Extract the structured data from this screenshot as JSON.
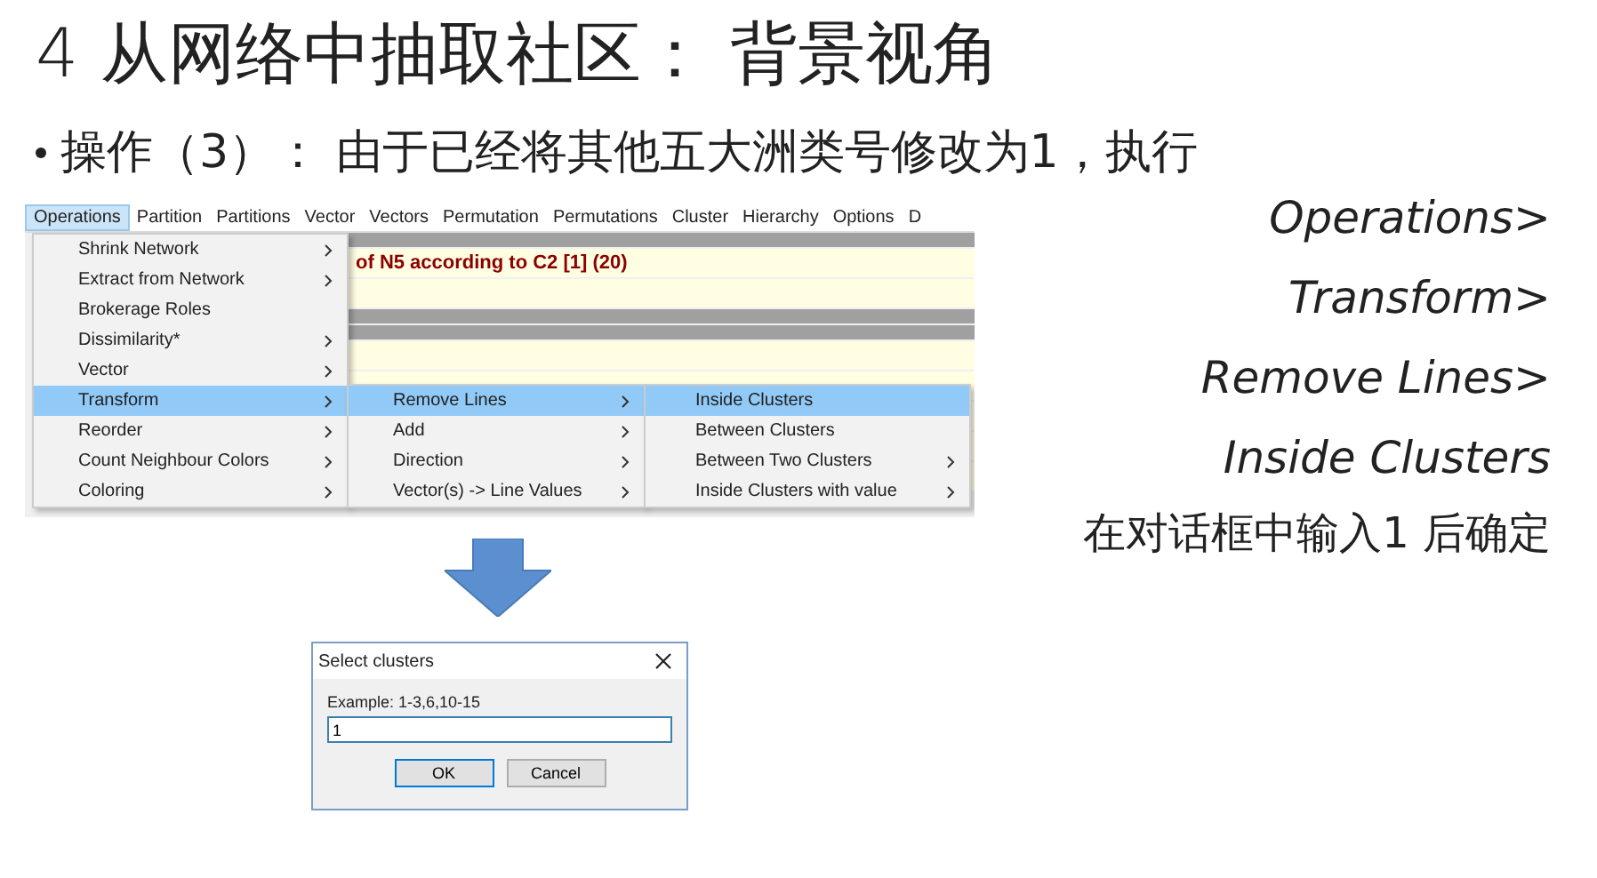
{
  "title": "4 从网络中抽取社区： 背景视角",
  "bullet": "操作（3）： 由于已经将其他五大洲类号修改为1，执行",
  "menubar": [
    {
      "label": "Operations",
      "selected": true
    },
    {
      "label": "Partition",
      "selected": false
    },
    {
      "label": "Partitions",
      "selected": false
    },
    {
      "label": "Vector",
      "selected": false
    },
    {
      "label": "Vectors",
      "selected": false
    },
    {
      "label": "Permutation",
      "selected": false
    },
    {
      "label": "Permutations",
      "selected": false
    },
    {
      "label": "Cluster",
      "selected": false
    },
    {
      "label": "Hierarchy",
      "selected": false
    },
    {
      "label": "Options",
      "selected": false
    },
    {
      "label": "D",
      "selected": false
    }
  ],
  "background_rows": [
    {
      "kind": "bar"
    },
    {
      "kind": "text",
      "text": "of N5 according to C2 [1] (20)"
    },
    {
      "kind": "blank"
    },
    {
      "kind": "bar"
    },
    {
      "kind": "bar"
    },
    {
      "kind": "blank"
    },
    {
      "kind": "blank"
    },
    {
      "kind": "blank"
    },
    {
      "kind": "blank"
    },
    {
      "kind": "blank"
    }
  ],
  "menu": [
    {
      "label": "Shrink  Network",
      "submenu": true,
      "selected": false
    },
    {
      "label": "Extract from Network",
      "submenu": true,
      "selected": false
    },
    {
      "label": "Brokerage Roles",
      "submenu": false,
      "selected": false
    },
    {
      "label": "Dissimilarity*",
      "submenu": true,
      "selected": false
    },
    {
      "label": "Vector",
      "submenu": true,
      "selected": false
    },
    {
      "label": "Transform",
      "submenu": true,
      "selected": true
    },
    {
      "label": "Reorder",
      "submenu": true,
      "selected": false
    },
    {
      "label": "Count Neighbour Colors",
      "submenu": true,
      "selected": false
    },
    {
      "label": "Coloring",
      "submenu": true,
      "selected": false
    }
  ],
  "submenu": [
    {
      "label": "Remove Lines",
      "submenu": true,
      "selected": true
    },
    {
      "label": "Add",
      "submenu": true,
      "selected": false
    },
    {
      "label": "Direction",
      "submenu": true,
      "selected": false
    },
    {
      "label": "Vector(s) -> Line Values",
      "submenu": true,
      "selected": false
    }
  ],
  "subsubmenu": [
    {
      "label": "Inside Clusters",
      "submenu": false,
      "selected": true
    },
    {
      "label": "Between Clusters",
      "submenu": false,
      "selected": false
    },
    {
      "label": "Between Two Clusters",
      "submenu": true,
      "selected": false
    },
    {
      "label": "Inside Clusters with value",
      "submenu": true,
      "selected": false
    }
  ],
  "path": [
    "Operations>",
    "Transform>",
    "Remove Lines>",
    "Inside Clusters"
  ],
  "instruction": "在对话框中输入1 后确定",
  "dialog": {
    "title": "Select clusters",
    "hint": "Example: 1-3,6,10-15",
    "value": "1",
    "buttons": [
      {
        "label": "OK",
        "default": true
      },
      {
        "label": "Cancel",
        "default": false
      }
    ]
  }
}
